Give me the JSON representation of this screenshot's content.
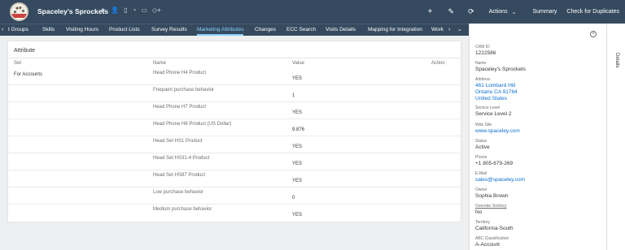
{
  "header": {
    "title": "Spaceley's Sprockets",
    "icons": [
      "star-icon",
      "person-icon",
      "document-icon",
      "rss-icon",
      "chat-icon",
      "tag-add-icon"
    ],
    "actions": {
      "add": "+",
      "edit": "✎",
      "refresh": "⟳",
      "actions_label": "Actions",
      "summary_label": "Summary",
      "check_duplicates_label": "Check for Duplicates"
    }
  },
  "tabs": [
    {
      "label": "t Groups"
    },
    {
      "label": "Skills"
    },
    {
      "label": "Visiting Hours"
    },
    {
      "label": "Product Lists"
    },
    {
      "label": "Survey Results"
    },
    {
      "label": "Marketing Attributes"
    },
    {
      "label": "Changes"
    },
    {
      "label": "ECC Search"
    },
    {
      "label": "Visits Details"
    },
    {
      "label": "Mapping for Integration"
    },
    {
      "label": "Work"
    }
  ],
  "panel": {
    "title": "Attribute",
    "columns": {
      "set": "Set",
      "name": "Name",
      "value": "Value",
      "action": "Action"
    },
    "rows": [
      {
        "set": "For Accounts",
        "name": "Head Phone H4 Product",
        "value": "YES"
      },
      {
        "set": "",
        "name": "Frequent purchase behavior",
        "value": "1"
      },
      {
        "set": "",
        "name": "Head Phone H7 Product",
        "value": "YES"
      },
      {
        "set": "",
        "name": "Head Phone H8 Product (US Dollar)",
        "value": "9.876"
      },
      {
        "set": "",
        "name": "Head Set HS1 Product",
        "value": "YES"
      },
      {
        "set": "",
        "name": "Head Set HS31-4 Product",
        "value": "YES"
      },
      {
        "set": "",
        "name": "Head Set HS87 Product",
        "value": "YES"
      },
      {
        "set": "",
        "name": "Low purchase behavior",
        "value": "0"
      },
      {
        "set": "",
        "name": "Medium purchase behavior",
        "value": "YES"
      }
    ]
  },
  "details": {
    "crm_id_label": "CRM ID",
    "crm_id": "1222586",
    "name_label": "Name",
    "name": "Spaceley's Sprockets",
    "address_label": "Address",
    "address_line1": "461 Lombard Hill",
    "address_line2": "Ontario CA 91764",
    "address_line3": "United States",
    "service_level_label": "Service Level",
    "service_level": "Service Level 2",
    "website_label": "Web Site",
    "website": "www.spaceley.com",
    "status_label": "Status",
    "status": "Active",
    "phone_label": "Phone",
    "phone": "+1 805-679-269",
    "email_label": "E-Mail",
    "email": "sales@spaceley.com",
    "owner_label": "Owner",
    "owner": "Sophia Brown",
    "override_territory_label": "Override Territory",
    "override_territory": "No",
    "territory_label": "Territory",
    "territory": "California-South",
    "abc_label": "ABC Classification",
    "abc": "A-Account"
  },
  "side_tab": {
    "label": "Details"
  },
  "colors": {
    "shell": "#354a5f",
    "accent": "#8fd0ff",
    "link": "#0a6ed1"
  }
}
